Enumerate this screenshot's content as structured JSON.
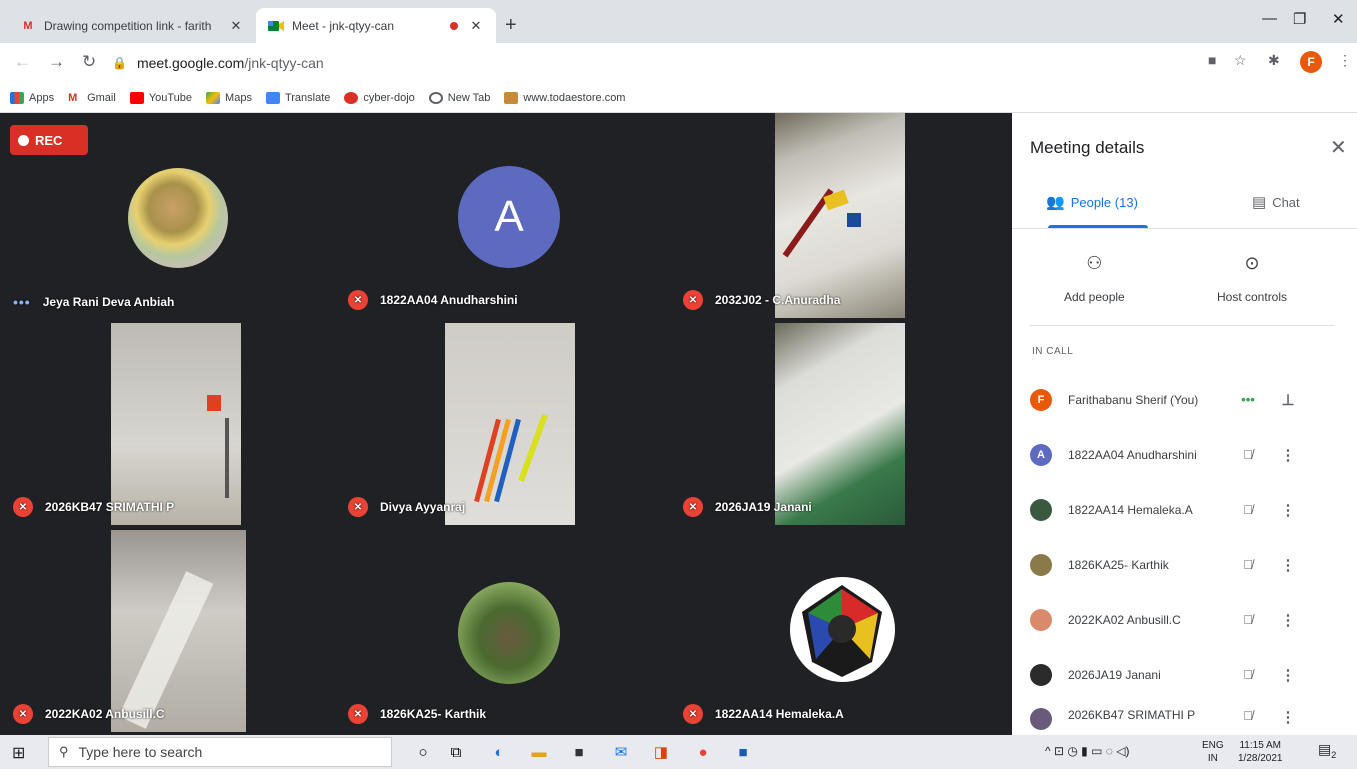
{
  "browser": {
    "tabs": [
      {
        "title": "Drawing competition link - farith",
        "icon": "gmail-icon"
      },
      {
        "title": "Meet - jnk-qtyy-can",
        "icon": "meet-icon"
      }
    ],
    "url_host": "meet.google.com",
    "url_path": "/jnk-qtyy-can",
    "bookmarks": [
      "Apps",
      "Gmail",
      "YouTube",
      "Maps",
      "Translate",
      "cyber-dojo",
      "New Tab",
      "www.todaestore.com"
    ],
    "profile_initial": "F"
  },
  "meet": {
    "rec_label": "REC",
    "tiles": [
      {
        "name": "Jeya Rani Deva Anbiah",
        "muted": false
      },
      {
        "name": "1822AA04 Anudharshini",
        "muted": true,
        "initial": "A"
      },
      {
        "name": "2032J02 - C.Anuradha",
        "muted": true
      },
      {
        "name": "2026KB47 SRIMATHI P",
        "muted": true
      },
      {
        "name": "Divya Ayyanraj",
        "muted": true
      },
      {
        "name": "2026JA19 Janani",
        "muted": true
      },
      {
        "name": "2022KA02 Anbusill.C",
        "muted": true
      },
      {
        "name": "1826KA25- Karthik",
        "muted": true
      },
      {
        "name": "1822AA14 Hemaleka.A",
        "muted": true
      }
    ]
  },
  "panel": {
    "title": "Meeting details",
    "tab_people": "People (13)",
    "tab_chat": "Chat",
    "add_people": "Add people",
    "host_controls": "Host controls",
    "in_call": "IN CALL",
    "people": [
      {
        "name": "Farithabanu Sherif (You)",
        "initial": "F",
        "color": "#e8590c"
      },
      {
        "name": "1822AA04 Anudharshini",
        "initial": "A",
        "color": "#5c6bc0"
      },
      {
        "name": "1822AA14 Hemaleka.A",
        "initial": "",
        "color": "#3a5a40"
      },
      {
        "name": "1826KA25- Karthik",
        "initial": "",
        "color": "#8a7a4a"
      },
      {
        "name": "2022KA02 Anbusill.C",
        "initial": "",
        "color": "#d98a6a"
      },
      {
        "name": "2026JA19 Janani",
        "initial": "",
        "color": "#2b2b2b"
      },
      {
        "name": "2026KB47 SRIMATHI P",
        "initial": "",
        "color": "#6a5a7a"
      }
    ]
  },
  "taskbar": {
    "search_placeholder": "Type here to search",
    "lang": "ENG",
    "region": "IN",
    "time": "11:15 AM",
    "date": "1/28/2021",
    "notif_count": "2"
  }
}
